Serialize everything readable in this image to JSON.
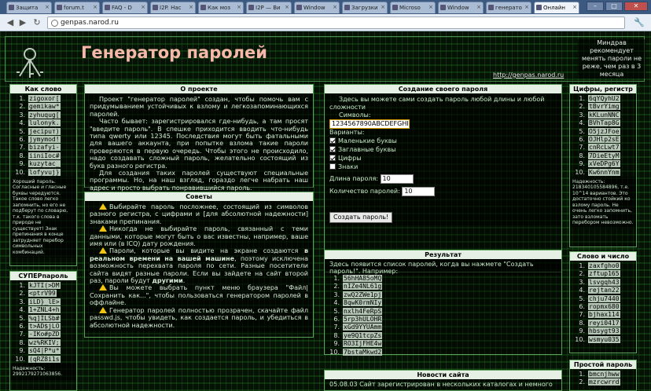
{
  "browser": {
    "tabs": [
      {
        "label": "Защита"
      },
      {
        "label": "forum.t"
      },
      {
        "label": "FAQ - D"
      },
      {
        "label": "I2P. Нас"
      },
      {
        "label": "Как моз"
      },
      {
        "label": "I2P — Ви"
      },
      {
        "label": "Window"
      },
      {
        "label": "Загрузки"
      },
      {
        "label": "Microso"
      },
      {
        "label": "Window"
      },
      {
        "label": "генерато"
      },
      {
        "label": "Онлайн"
      }
    ],
    "url": "genpas.narod.ru"
  },
  "header": {
    "title": "Генератор паролей",
    "url": "http://genpas.narod.ru",
    "note": "Миндрав рекомендует менять пароли не реже, чем раз в 3 месяца"
  },
  "word_panel": {
    "title": "Как слово",
    "items": [
      {
        "n": "1.",
        "v": "zigoxoг["
      },
      {
        "n": "2.",
        "v": "gemikaw*"
      },
      {
        "n": "3.",
        "v": "zyhuqug["
      },
      {
        "n": "4.",
        "v": "lulonyk."
      },
      {
        "n": "5.",
        "v": "jecipuт)"
      },
      {
        "n": "6.",
        "v": "jymymod!"
      },
      {
        "n": "7.",
        "v": "bizafyi-"
      },
      {
        "n": "8.",
        "v": "iiniIoc#"
      },
      {
        "n": "9.",
        "v": "kuzytac_"
      },
      {
        "n": "10.",
        "v": "lofyvuj}"
      }
    ],
    "note": "Хороший пароль. Согласные и гласные буквы чередуются. Такое слово легко запомнить, но его не подберут по словарю, т.к. такого слова в природе не существует! Знак препинания в конце затрудняет перебор символьных комбинаций."
  },
  "super_panel": {
    "title": "СУПЕРпароль",
    "items": [
      {
        "n": "1.",
        "v": "kJTI(>DM"
      },
      {
        "n": "2.",
        "v": "<ptrV99"
      },
      {
        "n": "3.",
        "v": "iLD}_lE>"
      },
      {
        "n": "4.",
        "v": "1+ZNL4+h"
      },
      {
        "n": "5.",
        "v": "%q]ILSb#"
      },
      {
        "n": "6.",
        "v": "t>AD$jLO"
      },
      {
        "n": "7.",
        "v": "-IKo#pZD"
      },
      {
        "n": "8.",
        "v": "wz%RKIV;"
      },
      {
        "n": "9.",
        "v": "sQ4|P*u*"
      },
      {
        "n": "10.",
        "v": "(qRZ8i1s"
      }
    ],
    "note": "Надежность: 2992179271063856."
  },
  "about": {
    "title": "О проекте",
    "paragraphs": [
      "Проект \"генератор паролей\" создан, чтобы помочь вам с придумыванием устойчивых к взлому и легкозапоминающихся паролей.",
      "Часто бывает: зарегистрировался где-нибудь, а там просят \"введите пароль\". В спешке приходится вводить что-нибудь типа qwerty или 12345. Последствия могут быть фатальными для вашего аккаунта, при попытке взлома такие пароли проверяются в первую очередь. Чтобы этого не происходило, надо создавать сложный пароль, желательно состоящий из букв разного регистра.",
      "Для создания таких паролей существуют специальные программы. Но, на наш взгляд, гораздо легче набрать наш адрес и просто выбрать понравившийся пароль."
    ]
  },
  "tips": {
    "title": "Советы",
    "t1": "Выбирайте пароль посложнее, состоящий из символов разного регистра, с цифрами и [для абсолютной надежности] знаками препинания.",
    "t2": "Никогда не выбирайте пароль, связанный с теми данными, которые могут быть о вас известны, например, ваше имя или (в ICQ) дату рождения.",
    "t3a": "Пароли, которые вы видите на экране создаются",
    "t3b": "в реальном времени на вашей машине",
    "t3c": ", поэтому исключена возможность перехвата пароля по сети. Разные посетители сайта видят разные пароли. Если вы зайдете на сайт второй раз, пароли будут",
    "t3d": "другими",
    "t3e": ".",
    "t4": "Вы можете выбрать пункт меню браузера \"Файл|Сохранить как...\", чтобы пользоваться генератором паролей в оффлайне.",
    "t5": "Генератор паролей полностью прозрачен, скачайте файл passwd.js, чтобы увидеть, как создается пароль, и убедиться в абсолютной надежности."
  },
  "create": {
    "title": "Создание своего пароля",
    "intro": "Здесь вы можете сами создать пароль любой длины и любой сложности",
    "symbols_label": "Символы:",
    "symbols_value": "1234567890ABCDEFGHI",
    "variants_label": "Варианты:",
    "options": [
      {
        "label": "Маленькие буквы",
        "checked": true
      },
      {
        "label": "Заглавные буквы",
        "checked": true
      },
      {
        "label": "Цифры",
        "checked": true
      },
      {
        "label": "Знаки",
        "checked": false
      }
    ],
    "length_label": "Длина пароля:",
    "length_value": "10",
    "count_label": "Количество паролей:",
    "count_value": "10",
    "button": "Создать пароль!"
  },
  "result": {
    "title": "Результат",
    "intro": "Здесь появится список паролей, когда вы нажмете \"Создать пароль!\". Например:",
    "items": [
      {
        "n": "1.",
        "v": "56hHA85oMQ"
      },
      {
        "n": "2.",
        "v": "nIZe4NL61g"
      },
      {
        "n": "3.",
        "v": "zwQ2ZWe1pj"
      },
      {
        "n": "4.",
        "v": "8qwK0rmNIy"
      },
      {
        "n": "5.",
        "v": "nxlh4FeRpS"
      },
      {
        "n": "6.",
        "v": "5rp3hULOHR"
      },
      {
        "n": "7.",
        "v": "xGd9YYUAmm"
      },
      {
        "n": "8.",
        "v": "ye9Q1tcpZs"
      },
      {
        "n": "9.",
        "v": "RO3IjFHE4w"
      },
      {
        "n": "10.",
        "v": "7bstaMkwd2"
      }
    ]
  },
  "news": {
    "title": "Новости сайта",
    "text": "05.08.03 Сайт зарегистрирован в нескольких каталогах и немного"
  },
  "digits_panel": {
    "title": "Цифры, регистр",
    "items": [
      {
        "n": "1.",
        "v": "6qYQyhU2"
      },
      {
        "n": "2.",
        "v": "tBvrYimg"
      },
      {
        "n": "3.",
        "v": "kKLunNNC"
      },
      {
        "n": "4.",
        "v": "BVhTap8G"
      },
      {
        "n": "5.",
        "v": "O5jzJFoe"
      },
      {
        "n": "6.",
        "v": "OJHlp2sE"
      },
      {
        "n": "7.",
        "v": "cnRcLwt7"
      },
      {
        "n": "8.",
        "v": "7DieEtyM"
      },
      {
        "n": "9.",
        "v": "xVeDPg6Y"
      },
      {
        "n": "10.",
        "v": "Kw6nnYnm"
      }
    ],
    "note": "Надежность: 218340105584896, т.е. 10^14 вариантов. Это достаточно стойкий ко взлому пароль. Не очень легко запомнить, зато взломать перебором невозможно."
  },
  "wordnum_panel": {
    "title": "Слово и число",
    "items": [
      {
        "n": "1.",
        "v": "zaxfgho0"
      },
      {
        "n": "2.",
        "v": "zftup165"
      },
      {
        "n": "3.",
        "v": "lsvgqh43"
      },
      {
        "n": "4.",
        "v": "rejtan22"
      },
      {
        "n": "5.",
        "v": "chju7440"
      },
      {
        "n": "6.",
        "v": "ropmx680"
      },
      {
        "n": "7.",
        "v": "bjhax114"
      },
      {
        "n": "8.",
        "v": "reyi0417"
      },
      {
        "n": "9.",
        "v": "hbsygt93"
      },
      {
        "n": "10.",
        "v": "wsmyu035"
      }
    ]
  },
  "simple_panel": {
    "title": "Простой пароль",
    "items": [
      {
        "n": "1.",
        "v": "bmcnjhww"
      },
      {
        "n": "2.",
        "v": "mzrcwrrd"
      }
    ]
  },
  "colors": {
    "title": "#f6b8a8",
    "panel_head": "#e6f0e4",
    "border": "#5aa05a",
    "warn": "#f1c40f"
  }
}
